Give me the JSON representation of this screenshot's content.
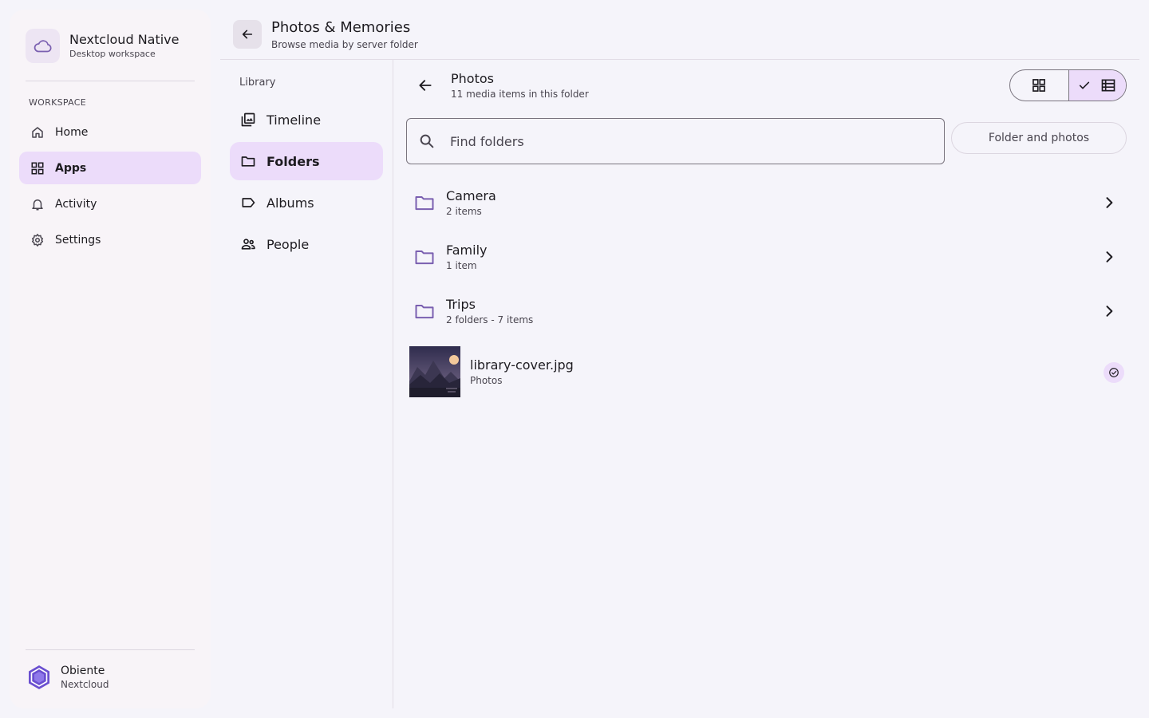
{
  "brand": {
    "title": "Nextcloud Native",
    "subtitle": "Desktop workspace",
    "icon": "cloud-icon"
  },
  "sidebar": {
    "section_label": "WORKSPACE",
    "items": [
      {
        "label": "Home",
        "icon": "home-icon",
        "active": false
      },
      {
        "label": "Apps",
        "icon": "apps-grid-icon",
        "active": true
      },
      {
        "label": "Activity",
        "icon": "bell-icon",
        "active": false
      },
      {
        "label": "Settings",
        "icon": "gear-icon",
        "active": false
      }
    ]
  },
  "user": {
    "name": "Obiente",
    "server": "Nextcloud",
    "icon": "hexagon-avatar-icon"
  },
  "header": {
    "title": "Photos & Memories",
    "subtitle": "Browse media by server folder"
  },
  "library": {
    "label": "Library",
    "items": [
      {
        "label": "Timeline",
        "icon": "photo-library-icon",
        "active": false
      },
      {
        "label": "Folders",
        "icon": "folder-icon",
        "active": true
      },
      {
        "label": "Albums",
        "icon": "label-icon",
        "active": false
      },
      {
        "label": "People",
        "icon": "people-icon",
        "active": false
      }
    ]
  },
  "folder": {
    "title": "Photos",
    "subtitle": "11 media items in this folder"
  },
  "view_toggle": {
    "options": [
      "grid",
      "list"
    ],
    "selected": "list"
  },
  "search": {
    "placeholder": "Find folders",
    "value": ""
  },
  "filter": {
    "label": "Folder and photos"
  },
  "rows": [
    {
      "title": "Camera",
      "subtitle": "2 items",
      "type": "folder"
    },
    {
      "title": "Family",
      "subtitle": "1 item",
      "type": "folder"
    },
    {
      "title": "Trips",
      "subtitle": "2 folders - 7 items",
      "type": "folder"
    },
    {
      "title": "library-cover.jpg",
      "subtitle": "Photos",
      "type": "image",
      "status": "synced"
    }
  ],
  "colors": {
    "accent": "#6750a4",
    "accent_container": "#ecdcfa",
    "background": "#f5f4fa",
    "sidebar": "#f8f4f8"
  }
}
